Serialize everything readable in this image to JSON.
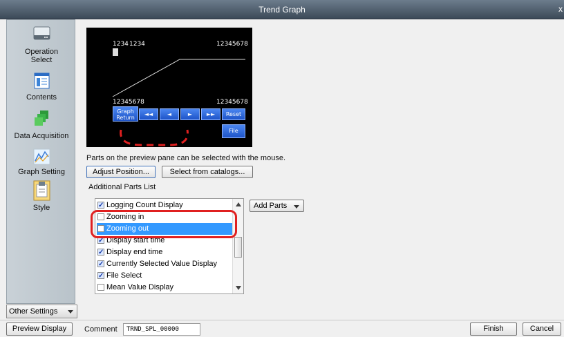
{
  "window": {
    "title": "Trend Graph",
    "close_label": "x"
  },
  "sidebar": {
    "items": [
      {
        "label": "Operation\nSelect",
        "icon": "operation-select-icon"
      },
      {
        "label": "Contents",
        "icon": "contents-icon"
      },
      {
        "label": "Data Acquisition",
        "icon": "data-acquisition-icon"
      },
      {
        "label": "Graph Setting",
        "icon": "graph-setting-icon"
      },
      {
        "label": "Style",
        "icon": "style-icon"
      }
    ],
    "other_settings": "Other Settings"
  },
  "preview": {
    "top_left_a": "1234",
    "top_left_b": "1234",
    "top_right": "12345678",
    "bottom_left": "12345678",
    "bottom_right": "12345678",
    "buttons": {
      "graph_return": "Graph\nReturn",
      "rewind": "◄◄",
      "back": "◄",
      "forward": "►",
      "fast_forward": "►►",
      "reset": "Reset",
      "file": "File"
    }
  },
  "hint": "Parts on the preview pane can be selected with the mouse.",
  "buttons": {
    "adjust_position": "Adjust Position...",
    "select_from_catalogs": "Select from catalogs...",
    "add_parts": "Add Parts",
    "preview_display": "Preview Display",
    "finish": "Finish",
    "cancel": "Cancel"
  },
  "additional_parts": {
    "heading": "Additional Parts List",
    "items": [
      {
        "label": "Logging Count Display",
        "checked": true
      },
      {
        "label": "Zooming in",
        "checked": false
      },
      {
        "label": "Zooming out",
        "checked": false,
        "selected": true
      },
      {
        "label": "Display start time",
        "checked": true
      },
      {
        "label": "Display end time",
        "checked": true
      },
      {
        "label": "Currently Selected Value Display",
        "checked": true
      },
      {
        "label": "File Select",
        "checked": true
      },
      {
        "label": "Mean Value Display",
        "checked": false
      }
    ]
  },
  "comment": {
    "label": "Comment",
    "value": "TRND_SPL_00000"
  },
  "colors": {
    "accent": "#3399ff",
    "highlight": "#e02020",
    "title_bar": "#4a5a6a"
  }
}
